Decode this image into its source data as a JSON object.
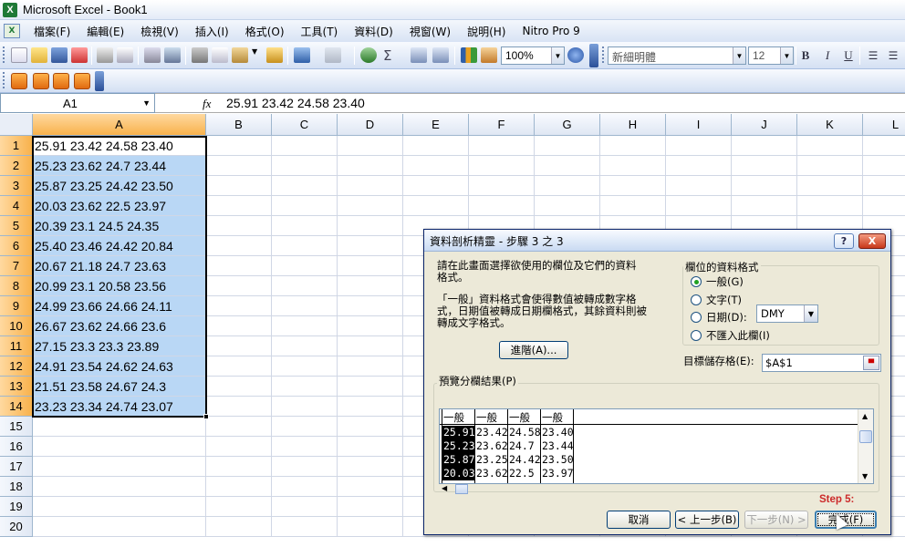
{
  "window": {
    "title": "Microsoft Excel - Book1",
    "app_icon": "excel-icon"
  },
  "menu": {
    "items": [
      "檔案(F)",
      "編輯(E)",
      "檢視(V)",
      "插入(I)",
      "格式(O)",
      "工具(T)",
      "資料(D)",
      "視窗(W)",
      "說明(H)",
      "Nitro Pro 9"
    ]
  },
  "toolbar": {
    "zoom": "100%",
    "font": "新細明體",
    "font_size": "12",
    "bold": "B",
    "italic": "I",
    "underline": "U"
  },
  "formula_bar": {
    "name_box": "A1",
    "fx": "fx",
    "value": "25.91 23.42 24.58 23.40"
  },
  "sheet": {
    "columns": [
      "A",
      "B",
      "C",
      "D",
      "E",
      "F",
      "G",
      "H",
      "I",
      "J",
      "K",
      "L"
    ],
    "rows": [
      "1",
      "2",
      "3",
      "4",
      "5",
      "6",
      "7",
      "8",
      "9",
      "10",
      "11",
      "12",
      "13",
      "14",
      "15",
      "16",
      "17",
      "18",
      "19",
      "20"
    ],
    "col_a": [
      "25.91 23.42 24.58 23.40",
      "25.23 23.62 24.7 23.44",
      "25.87 23.25 24.42 23.50",
      "20.03 23.62 22.5 23.97",
      "20.39 23.1 24.5 24.35",
      "25.40 23.46 24.42 20.84",
      "20.67 21.18 24.7 23.63",
      "20.99 23.1 20.58 23.56",
      "24.99 23.66 24.66 24.11",
      "26.67 23.62 24.66 23.6",
      "27.15 23.3 23.3 23.89",
      "24.91 23.54 24.62 24.63",
      "21.51 23.58 24.67 24.3",
      "23.23 23.34 24.74 23.07"
    ]
  },
  "dialog": {
    "title": "資料剖析精靈 - 步驟 3 之 3",
    "help": "?",
    "close": "X",
    "desc1_line1": "請在此畫面選擇欲使用的欄位及它們的資料",
    "desc1_line2": "格式。",
    "desc2_line1": "「一般」資料格式會使得數值被轉成數字格",
    "desc2_line2": "式，日期值被轉成日期欄格式，其餘資料則被",
    "desc2_line3": "轉成文字格式。",
    "advanced": "進階(A)...",
    "format_group": "欄位的資料格式",
    "options": [
      "一般(G)",
      "文字(T)",
      "日期(D):",
      "不匯入此欄(I)"
    ],
    "selected_option": "一般(G)",
    "date_format": "DMY",
    "dest_label": "目標儲存格(E):",
    "dest_value": "$A$1",
    "preview_label": "預覽分欄結果(P)",
    "preview_headers": [
      "一般",
      "一般",
      "一般",
      "一般"
    ],
    "preview_rows": [
      [
        "25.91",
        "23.42",
        "24.58",
        "23.40"
      ],
      [
        "25.23",
        "23.62",
        "24.7",
        "23.44"
      ],
      [
        "25.87",
        "23.25",
        "24.42",
        "23.50"
      ],
      [
        "20.03",
        "23.62",
        "22.5",
        "23.97"
      ]
    ],
    "cancel": "取消",
    "back": "< 上一步(B)",
    "next": "下一步(N) >",
    "finish": "完成(F)",
    "annotation": "Step 5:"
  },
  "colors": {
    "selection": "#b9d7f5",
    "header_selected": "#f8b24c",
    "annotation": "#cc2a2a"
  }
}
